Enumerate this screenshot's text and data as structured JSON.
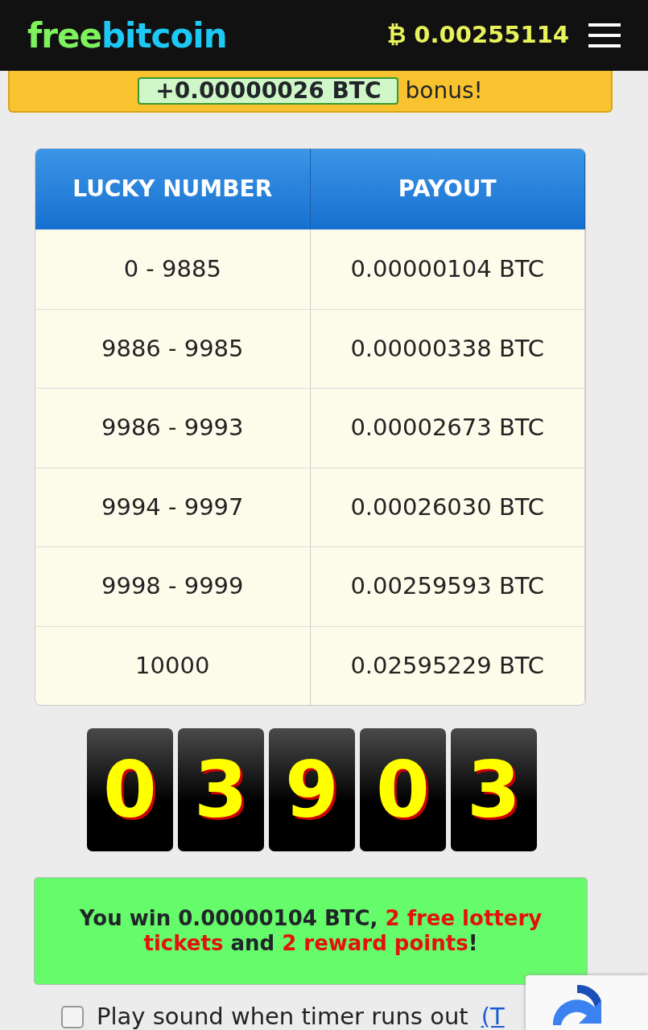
{
  "header": {
    "logo_parts": [
      {
        "text": "free",
        "color": "#7ef25c"
      },
      {
        "text": "bitcoin",
        "color": "#1ec8f5"
      }
    ],
    "currency_symbol": "₿",
    "balance": "0.00255114"
  },
  "bonus_banner": {
    "amount": "+0.00000026 BTC",
    "label": "bonus!"
  },
  "payout_table": {
    "columns": [
      "LUCKY NUMBER",
      "PAYOUT"
    ],
    "rows": [
      [
        "0 - 9885",
        "0.00000104 BTC"
      ],
      [
        "9886 - 9985",
        "0.00000338 BTC"
      ],
      [
        "9986 - 9993",
        "0.00002673 BTC"
      ],
      [
        "9994 - 9997",
        "0.00026030 BTC"
      ],
      [
        "9998 - 9999",
        "0.00259593 BTC"
      ],
      [
        "10000",
        "0.02595229 BTC"
      ]
    ]
  },
  "roll_digits": [
    "0",
    "3",
    "9",
    "0",
    "3"
  ],
  "result_message": [
    {
      "text": "You win 0.00000104 BTC, ",
      "highlight": false
    },
    {
      "text": "2 free lottery tickets",
      "highlight": true
    },
    {
      "text": " and ",
      "highlight": false
    },
    {
      "text": "2 reward points",
      "highlight": true
    },
    {
      "text": "!",
      "highlight": false
    }
  ],
  "sound_option": {
    "label": "Play sound when timer runs out",
    "link": "(T",
    "checked": false
  }
}
